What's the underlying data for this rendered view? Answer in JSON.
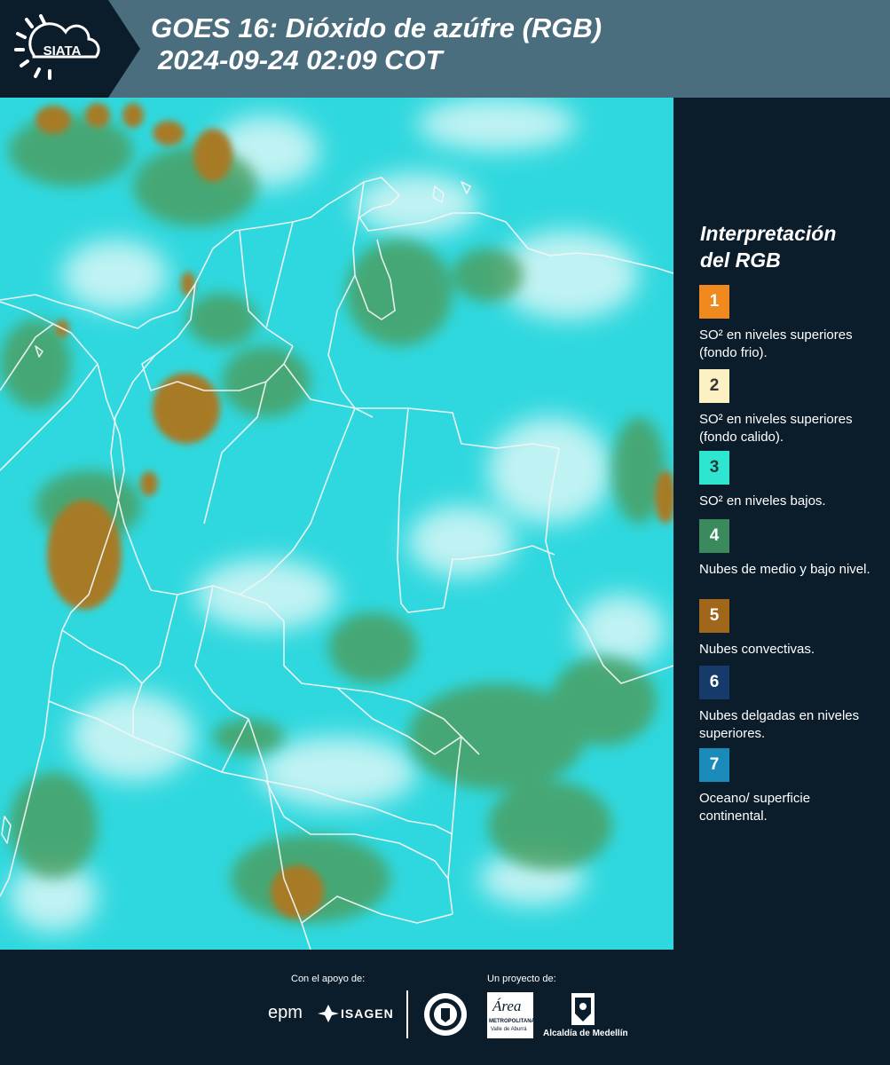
{
  "header": {
    "logo_text": "SIATA",
    "title_line1": "GOES 16: Dióxido de azúfre (RGB)",
    "title_line2": "2024-09-24 02:09 COT"
  },
  "legend": {
    "title_line1": "Interpretación",
    "title_line2": "del RGB",
    "items": [
      {
        "num": "1",
        "color": "#f08a1e",
        "num_color": "#ffffff",
        "label": "SO² en niveles superiores (fondo frio)."
      },
      {
        "num": "2",
        "color": "#fbf1c2",
        "num_color": "#333333",
        "label": "SO² en niveles superiores (fondo calido)."
      },
      {
        "num": "3",
        "color": "#2ee6d0",
        "num_color": "#1a3a3a",
        "label": "SO² en niveles bajos."
      },
      {
        "num": "4",
        "color": "#3a8a5e",
        "num_color": "#ffffff",
        "label": "Nubes de medio y bajo nivel."
      },
      {
        "num": "5",
        "color": "#a0661a",
        "num_color": "#ffffff",
        "label": "Nubes convectivas."
      },
      {
        "num": "6",
        "color": "#163a6a",
        "num_color": "#ffffff",
        "label": "Nubes delgadas en niveles superiores."
      },
      {
        "num": "7",
        "color": "#1a8ab8",
        "num_color": "#ffffff",
        "label": "Oceano/ superficie continental."
      }
    ]
  },
  "footer": {
    "support_caption": "Con el apoyo de:",
    "project_caption": "Un proyecto de:",
    "epm": "epm",
    "isagen": "ISAGEN",
    "area_metro_script": "Área",
    "area_metro_line1": "METROPOLITANA",
    "area_metro_line2": "Valle de Aburrá",
    "alcaldia": "Alcaldía de Medellín"
  },
  "colors": {
    "header_bg": "#4a6e7e",
    "page_bg": "#0b1d2b",
    "map_base": "#2fd8de",
    "cloud_green": "#4a9a58",
    "cloud_brown": "#a87c2a",
    "cloud_white": "#dff6f6"
  }
}
